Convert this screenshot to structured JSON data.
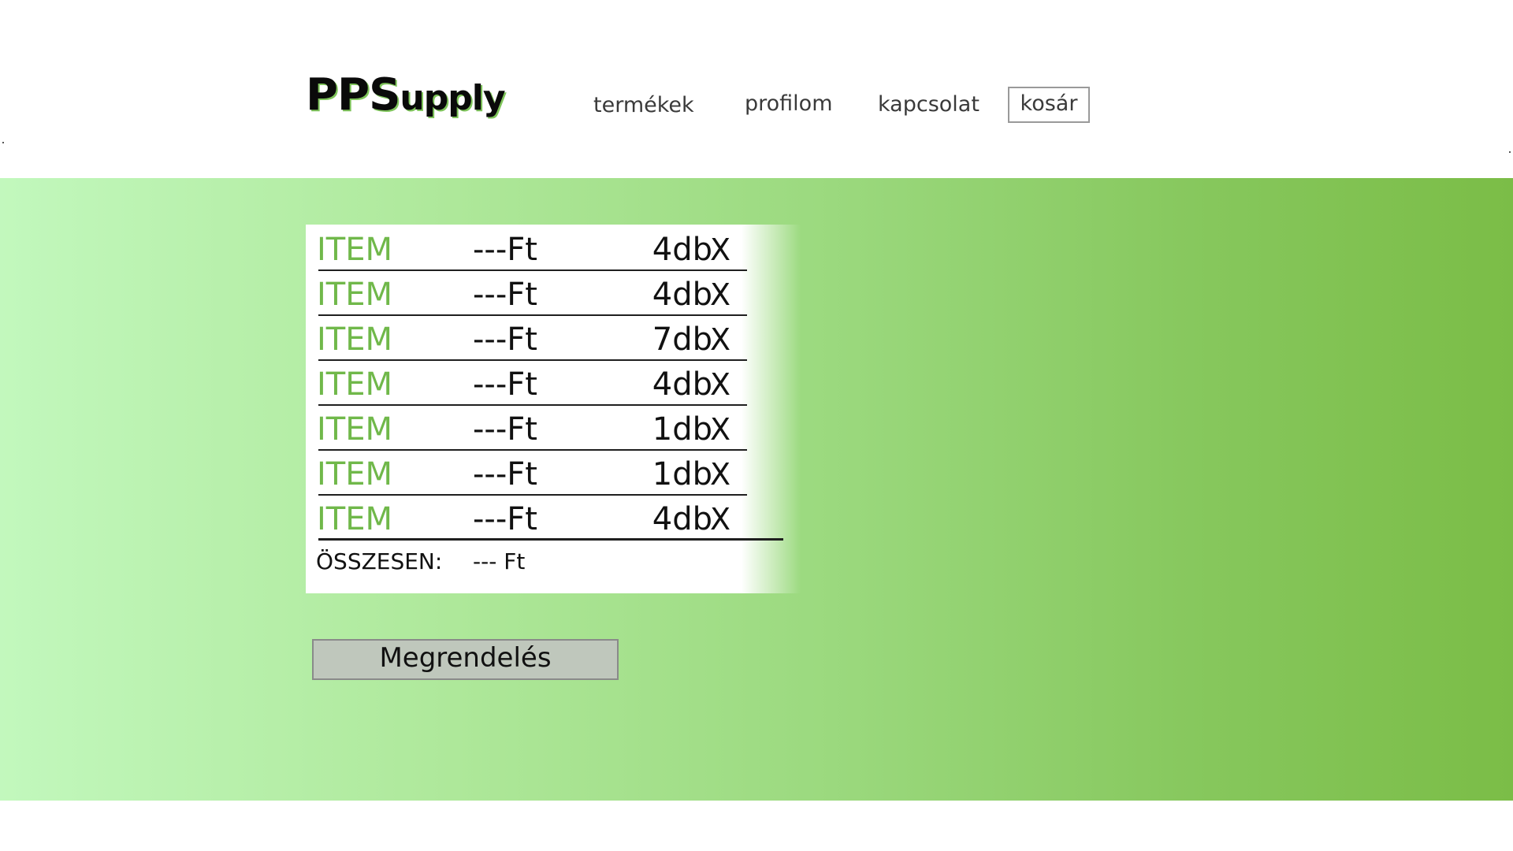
{
  "header": {
    "logo_big": "PPS",
    "logo_small": "upply",
    "nav": {
      "products": "termékek",
      "profile": "profilom",
      "contact": "kapcsolat",
      "cart": "kosár"
    }
  },
  "cart": {
    "items": [
      {
        "name": "ITEM",
        "price": "---Ft",
        "qty": "4db",
        "remove": "X"
      },
      {
        "name": "ITEM",
        "price": "---Ft",
        "qty": "4db",
        "remove": "X"
      },
      {
        "name": "ITEM",
        "price": "---Ft",
        "qty": "7db",
        "remove": "X"
      },
      {
        "name": "ITEM",
        "price": "---Ft",
        "qty": "4db",
        "remove": "X"
      },
      {
        "name": "ITEM",
        "price": "---Ft",
        "qty": "1db",
        "remove": "X"
      },
      {
        "name": "ITEM",
        "price": "---Ft",
        "qty": "1db",
        "remove": "X"
      },
      {
        "name": "ITEM",
        "price": "---Ft",
        "qty": "4db",
        "remove": "X"
      }
    ],
    "total_label": "ÖSSZESEN:",
    "total_value": "--- Ft"
  },
  "order_button": "Megrendelés",
  "colors": {
    "accent_green": "#70b84a",
    "gradient_start": "#c2f8bd",
    "gradient_end": "#7bbd47",
    "button_bg": "#bfc7bc"
  }
}
